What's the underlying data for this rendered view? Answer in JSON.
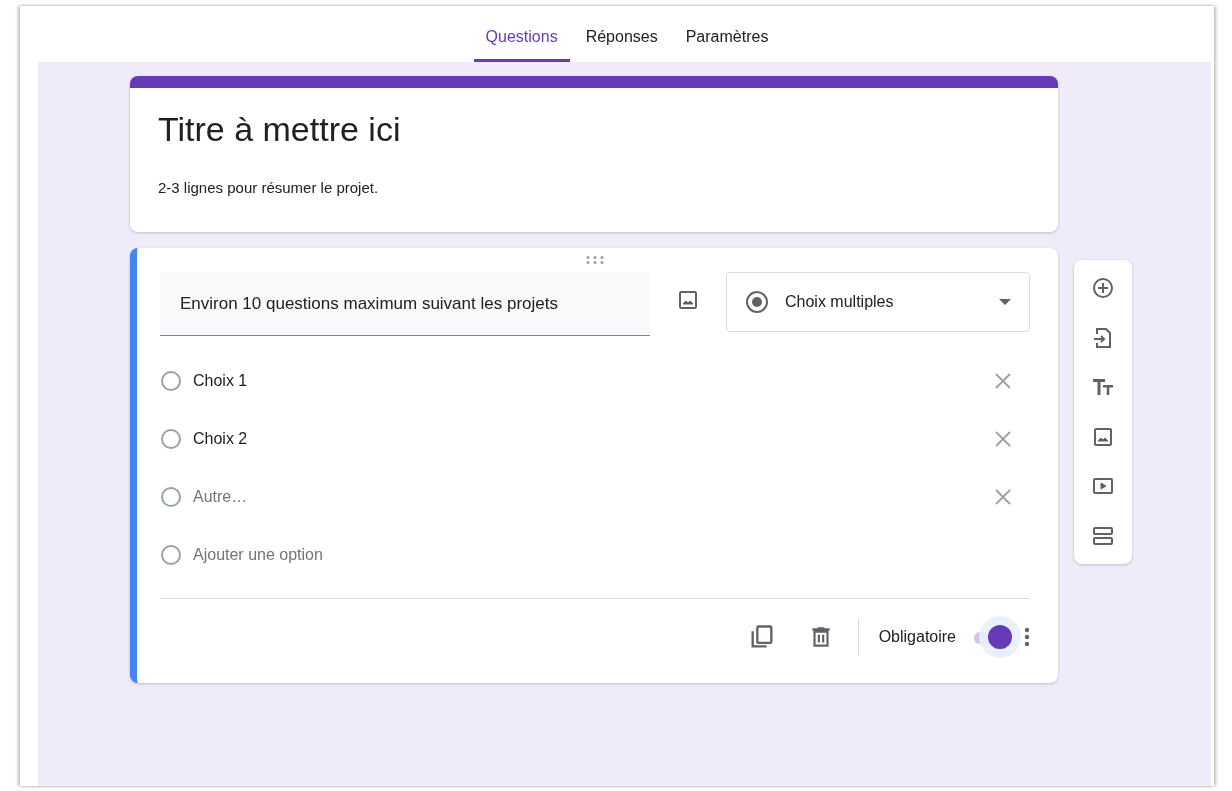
{
  "tabs": [
    {
      "label": "Questions",
      "selected": true
    },
    {
      "label": "Réponses",
      "selected": false
    },
    {
      "label": "Paramètres",
      "selected": false
    }
  ],
  "header": {
    "title": "Titre à mettre ici",
    "description": "2-3 lignes pour résumer le projet."
  },
  "question": {
    "title": "Environ 10 questions maximum suivant les projets",
    "type_select": "Choix multiples",
    "options": [
      {
        "kind": "choice",
        "label": "Choix 1",
        "selected": false
      },
      {
        "kind": "choice",
        "label": "Choix 2",
        "selected": false
      },
      {
        "kind": "other",
        "label": "Autre…",
        "selected": false
      },
      {
        "kind": "add",
        "label": "Ajouter une option",
        "selected": false
      }
    ],
    "required": {
      "label": "Obligatoire",
      "on": true
    }
  }
}
